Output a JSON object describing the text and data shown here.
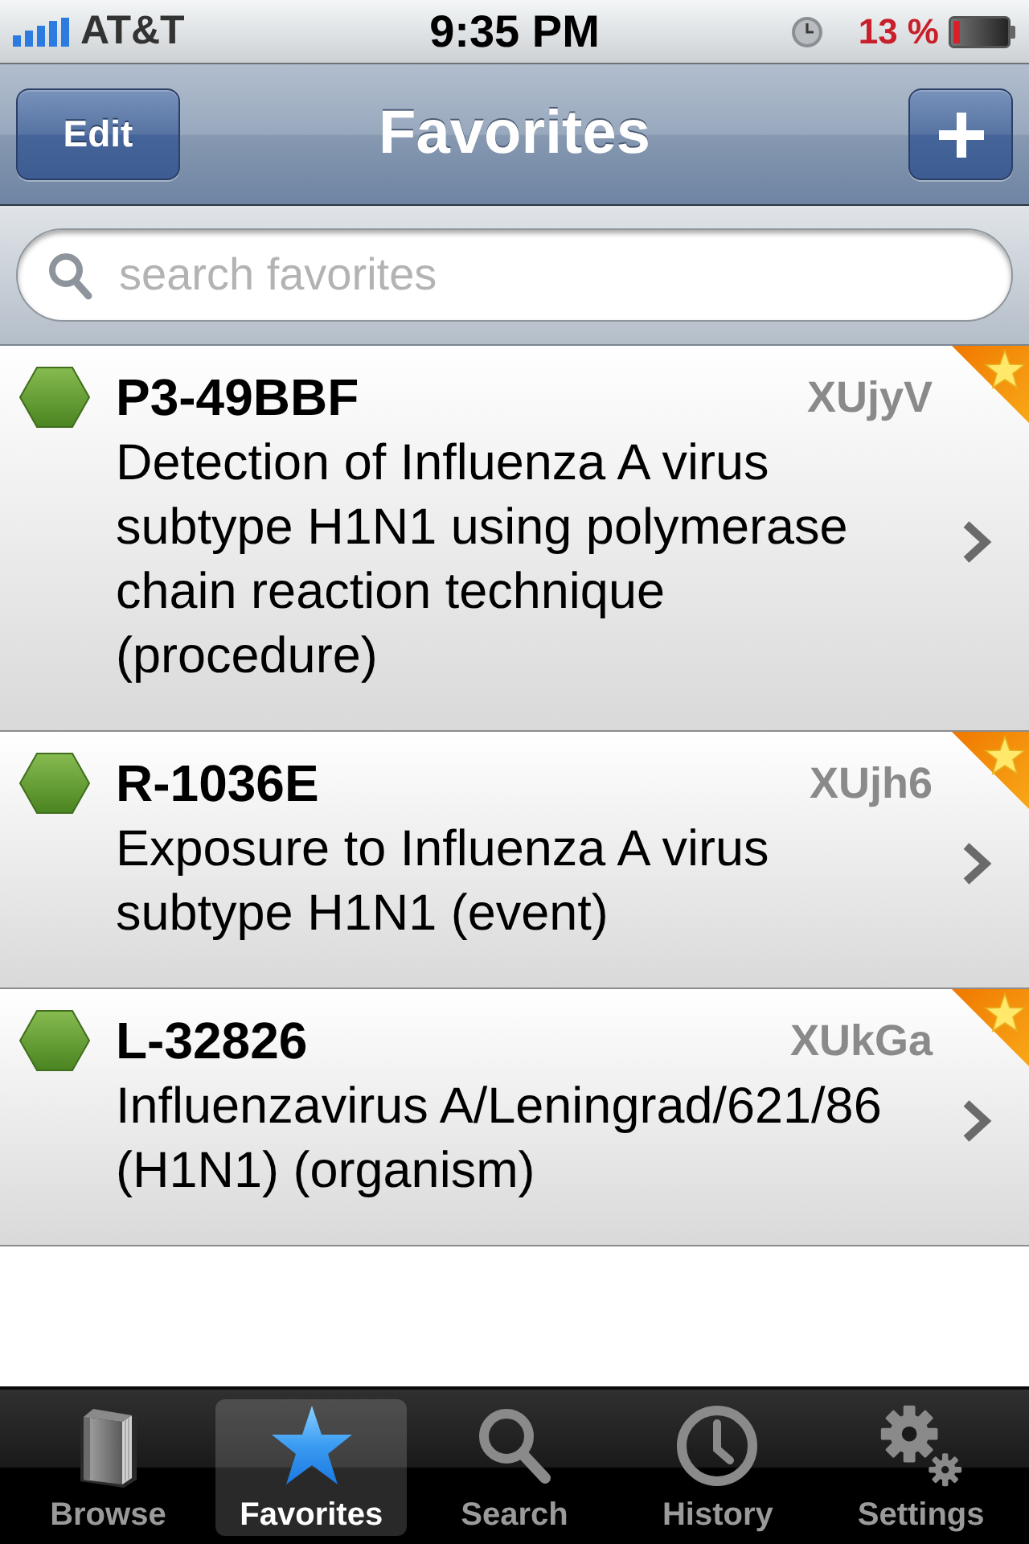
{
  "status_bar": {
    "carrier": "AT&T",
    "time": "9:35 PM",
    "battery": "13 %"
  },
  "nav_bar": {
    "left_button": "Edit",
    "title": "Favorites"
  },
  "search": {
    "placeholder": "search favorites"
  },
  "favorites": [
    {
      "code": "P3-49BBF",
      "id": "XUjyV",
      "description": "Detection of Influenza A virus subtype H1N1 using polymerase chain reaction technique (procedure)",
      "starred": true
    },
    {
      "code": "R-1036E",
      "id": "XUjh6",
      "description": "Exposure to Influenza A virus subtype H1N1 (event)",
      "starred": true
    },
    {
      "code": "L-32826",
      "id": "XUkGa",
      "description": "Influenzavirus A/Leningrad/621/86 (H1N1) (organism)",
      "starred": true
    }
  ],
  "tabs": {
    "items": [
      {
        "label": "Browse",
        "selected": false
      },
      {
        "label": "Favorites",
        "selected": true
      },
      {
        "label": "Search",
        "selected": false
      },
      {
        "label": "History",
        "selected": false
      },
      {
        "label": "Settings",
        "selected": false
      }
    ]
  }
}
